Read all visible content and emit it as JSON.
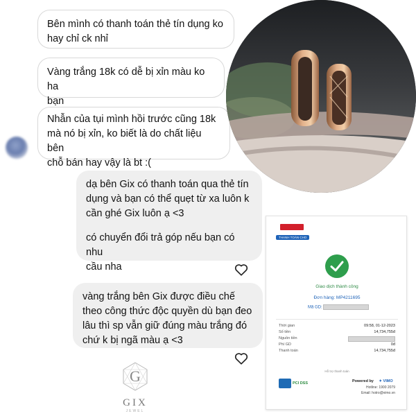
{
  "messages": {
    "m1": [
      "Bên mình có thanh toán thẻ tín dụng ko",
      "hay chỉ ck nhỉ"
    ],
    "m2": [
      "Vàng trắng 18k có dễ bị xỉn màu ko ha",
      "bạn"
    ],
    "m3": [
      "Nhẫn của tụi mình hồi trước cũng 18k",
      "mà nó bị xỉn, ko biết là do chất liệu bên",
      "chỗ bán hay vậy là bt :("
    ],
    "r1": [
      "dạ bên Gix có thanh toán qua thẻ tín",
      "dụng và bạn có thể quẹt từ xa luôn k",
      "cần ghé Gix luôn ạ <3",
      "",
      "có chuyển đổi trả góp nếu bạn có nhu",
      "cầu nha"
    ],
    "r2": [
      "vàng trắng bên Gix được điều chế",
      "theo công thức độc quyền dù bạn đeo",
      "lâu thì sp vẫn giữ đúng màu trắng đó",
      "chứ k bị ngã màu ạ <3"
    ]
  },
  "logo": {
    "letter": "G",
    "name": "GIX",
    "sub": "JEWEL"
  },
  "receipt": {
    "badge": "THANH TOÁN CHO",
    "status": "Giao dịch thành công",
    "order_label": "Đơn hàng: MP4211695",
    "code_label": "Mã GD:",
    "rows": [
      {
        "label": "Thời gian",
        "value": "09:58, 01-12-2023"
      },
      {
        "label": "Số tiền",
        "value": "14,734,755đ"
      },
      {
        "label": "Nguồn tiền",
        "value": ""
      },
      {
        "label": "Phí GD",
        "value": "0đ"
      },
      {
        "label": "Thanh toán",
        "value": "14,734,755đ"
      }
    ],
    "support": "Hỗ trợ thanh toán",
    "pci": "PCI DSS",
    "powered_by": "Powered by",
    "vimo": "VIMO",
    "hotline": "Hotline: 1900 2079",
    "email": "Email: hotro@vimo.vn"
  }
}
